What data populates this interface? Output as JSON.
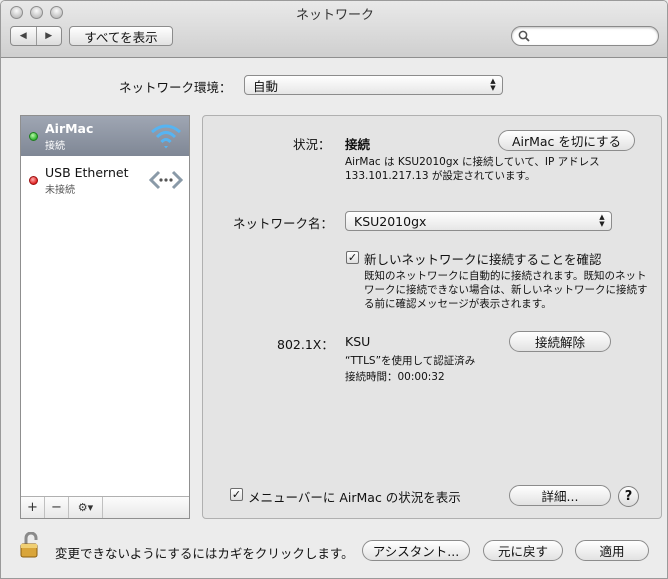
{
  "window": {
    "title": "ネットワーク"
  },
  "toolbar": {
    "back": "◀",
    "forward": "▶",
    "show_all_label": "すべてを表示",
    "search_placeholder": ""
  },
  "location": {
    "label": "ネットワーク環境：",
    "value": "自動"
  },
  "services": [
    {
      "name": "AirMac",
      "status": "接続",
      "selected": true,
      "status_color": "#2fb52f"
    },
    {
      "name": "USB Ethernet",
      "status": "未接続",
      "selected": false,
      "status_color": "#e02020"
    }
  ],
  "sidebar_tools": {
    "add": "+",
    "remove": "−",
    "action": "⚙▾"
  },
  "main": {
    "status_label": "状況：",
    "status_value": "接続",
    "toggle_airmac_label": "AirMac を切にする",
    "status_desc_line1": "AirMac は KSU2010gx に接続していて、IP アドレス",
    "status_desc_line2": "133.101.217.13 が設定されています。",
    "network_name_label": "ネットワーク名：",
    "network_name_value": "KSU2010gx",
    "confirm_join_label": "新しいネットワークに接続することを確認",
    "confirm_join_checked": true,
    "confirm_desc_line1": "既知のネットワークに自動的に接続されます。既知のネット",
    "confirm_desc_line2": "ワークに接続できない場合は、新しいネットワークに接続す",
    "confirm_desc_line3": "る前に確認メッセージが表示されます。",
    "dot1x_label": "802.1X：",
    "dot1x_value": "KSU",
    "disconnect_label": "接続解除",
    "dot1x_desc_line1": "“TTLS”を使用して認証済み",
    "dot1x_desc_line2": "接続時間：00:00:32",
    "show_menubar_label": "メニューバーに AirMac の状況を表示",
    "show_menubar_checked": true,
    "advanced_label": "詳細...",
    "help_label": "?"
  },
  "footer": {
    "lock_text": "変更できないようにするにはカギをクリックします。",
    "assistant_label": "アシスタント...",
    "revert_label": "元に戻す",
    "apply_label": "適用"
  },
  "colors": {
    "accent_wifi": "#3a9be0",
    "selection": "#8c93a0"
  }
}
